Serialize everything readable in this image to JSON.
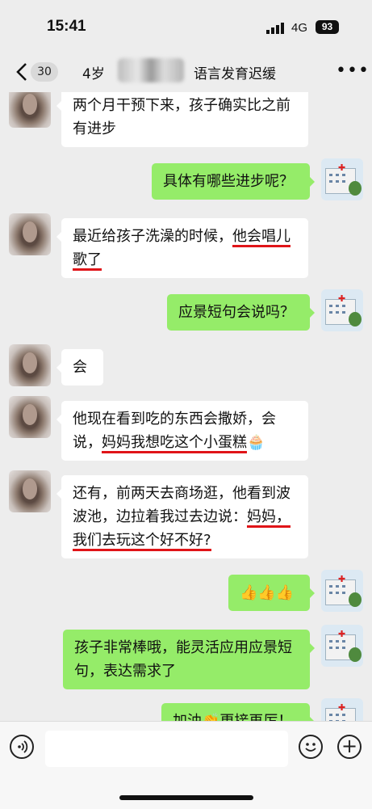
{
  "status_bar": {
    "time": "15:41",
    "network": "4G",
    "battery": "93"
  },
  "nav": {
    "unread_count": "30",
    "title_prefix": "4岁",
    "title_suffix": "语言发育迟缓"
  },
  "messages": [
    {
      "side": "left",
      "text": "两个月干预下来，孩子确实比之前有进步"
    },
    {
      "side": "right",
      "text": "具体有哪些进步呢？"
    },
    {
      "side": "left",
      "text_plain": "最近给孩子洗澡的时候，",
      "text_marked_1": "他会唱",
      "text_marked_2": "儿歌了"
    },
    {
      "side": "right",
      "text": "应景短句会说吗？"
    },
    {
      "side": "left",
      "text": "会"
    },
    {
      "side": "left",
      "text_plain": "他现在看到吃的东西会撒娇，会说，",
      "text_marked": "妈妈我想吃这个小蛋糕",
      "emoji": "🧁"
    },
    {
      "side": "left",
      "text_plain": "还有，前两天去商场逛，他看到波波池，边拉着我过去边说：",
      "text_marked_1": "妈",
      "text_marked_2": "妈，我们去玩这个好不好?"
    },
    {
      "side": "right",
      "text": "👍👍👍"
    },
    {
      "side": "right",
      "text": "孩子非常棒哦，能灵活应用应景短句，表达需求了"
    },
    {
      "side": "right",
      "text": "加油👏更接再厉！"
    }
  ]
}
